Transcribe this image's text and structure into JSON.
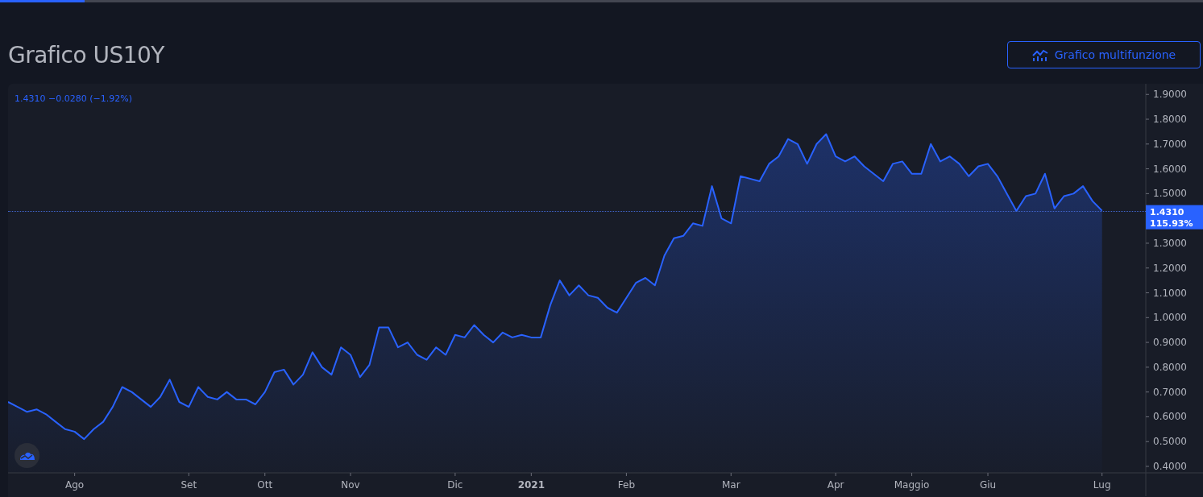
{
  "loading_bar": {
    "level": 0.07
  },
  "title": "Grafico US10Y",
  "action_button": {
    "label": "Grafico multifunzione"
  },
  "legend": "1.4310 −0.0280 (−1.92%)",
  "price_label": {
    "value": "1.4310",
    "percent": "115.93%"
  },
  "chart_data": {
    "type": "area",
    "categories": [
      null,
      null,
      null,
      null,
      null,
      null,
      null,
      "Ago",
      null,
      null,
      null,
      null,
      null,
      null,
      null,
      null,
      null,
      null,
      null,
      "Set",
      null,
      null,
      null,
      null,
      null,
      null,
      null,
      "Ott",
      null,
      null,
      null,
      null,
      null,
      null,
      null,
      null,
      "Nov",
      null,
      null,
      null,
      null,
      null,
      null,
      null,
      null,
      null,
      null,
      "Dic",
      null,
      null,
      null,
      null,
      null,
      null,
      null,
      "2021",
      null,
      null,
      null,
      null,
      null,
      null,
      null,
      null,
      null,
      "Feb",
      null,
      null,
      null,
      null,
      null,
      null,
      null,
      null,
      null,
      null,
      "Mar",
      null,
      null,
      null,
      null,
      null,
      null,
      null,
      null,
      null,
      null,
      "Apr",
      null,
      null,
      null,
      null,
      null,
      null,
      null,
      "Maggio",
      null,
      null,
      null,
      null,
      null,
      null,
      null,
      "Giu",
      null,
      null,
      null,
      null,
      null,
      null,
      null,
      null,
      null,
      null,
      null,
      "Lug"
    ],
    "series": [
      {
        "color": "#2962ff",
        "values": [
          0.66,
          0.64,
          0.62,
          0.63,
          0.61,
          0.58,
          0.55,
          0.54,
          0.51,
          0.55,
          0.58,
          0.64,
          0.72,
          0.7,
          0.67,
          0.64,
          0.68,
          0.75,
          0.66,
          0.64,
          0.72,
          0.68,
          0.67,
          0.7,
          0.67,
          0.67,
          0.65,
          0.7,
          0.78,
          0.79,
          0.73,
          0.77,
          0.86,
          0.8,
          0.77,
          0.88,
          0.85,
          0.76,
          0.81,
          0.96,
          0.96,
          0.88,
          0.9,
          0.85,
          0.83,
          0.88,
          0.85,
          0.93,
          0.92,
          0.97,
          0.93,
          0.9,
          0.94,
          0.92,
          0.93,
          0.92,
          0.92,
          1.05,
          1.15,
          1.09,
          1.13,
          1.09,
          1.08,
          1.04,
          1.02,
          1.08,
          1.14,
          1.16,
          1.13,
          1.25,
          1.32,
          1.33,
          1.38,
          1.37,
          1.53,
          1.4,
          1.38,
          1.57,
          1.56,
          1.55,
          1.62,
          1.65,
          1.72,
          1.7,
          1.62,
          1.7,
          1.74,
          1.65,
          1.63,
          1.65,
          1.61,
          1.58,
          1.55,
          1.62,
          1.63,
          1.58,
          1.58,
          1.7,
          1.63,
          1.65,
          1.62,
          1.57,
          1.61,
          1.62,
          1.57,
          1.5,
          1.43,
          1.49,
          1.5,
          1.58,
          1.44,
          1.49,
          1.5,
          1.53,
          1.47,
          1.431
        ]
      }
    ],
    "ylim": [
      0.374,
      1.943
    ],
    "yticks": [
      {
        "value": 1.9,
        "label": "1.9000"
      },
      {
        "value": 1.8,
        "label": "1.8000"
      },
      {
        "value": 1.7,
        "label": "1.7000"
      },
      {
        "value": 1.6,
        "label": "1.6000"
      },
      {
        "value": 1.5,
        "label": "1.5000"
      },
      {
        "value": 1.3,
        "label": "1.3000"
      },
      {
        "value": 1.2,
        "label": "1.2000"
      },
      {
        "value": 1.1,
        "label": "1.1000"
      },
      {
        "value": 1.0,
        "label": "1.0000"
      },
      {
        "value": 0.9,
        "label": "0.9000"
      },
      {
        "value": 0.8,
        "label": "0.8000"
      },
      {
        "value": 0.7,
        "label": "0.7000"
      },
      {
        "value": 0.6,
        "label": "0.6000"
      },
      {
        "value": 0.5,
        "label": "0.5000"
      },
      {
        "value": 0.4,
        "label": "0.4000"
      }
    ]
  }
}
